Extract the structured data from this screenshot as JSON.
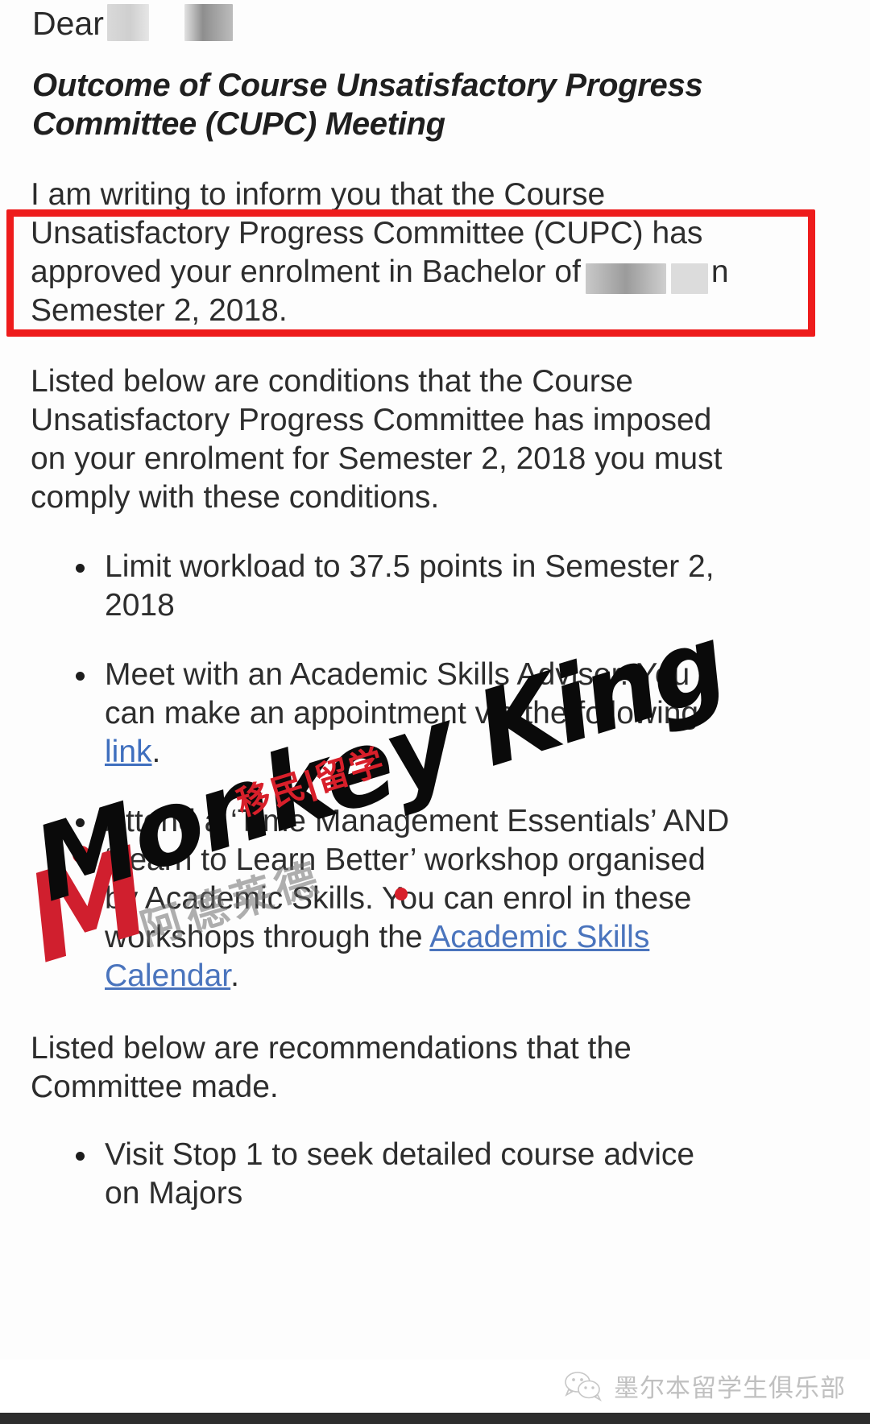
{
  "document": {
    "salutation": "Dear",
    "salutation_trailing": ",",
    "heading": "Outcome of Course Unsatisfactory Progress Committee (CUPC) Meeting",
    "intro_paragraph_part1": "I am writing to inform you that the Course Unsatisfactory Progress Committee (CUPC) has approved your enrolment in Bachelor of",
    "intro_paragraph_part2": "n Semester 2, 2018.",
    "conditions_paragraph": "Listed below are conditions that the Course Unsatisfactory Progress Committee has imposed on your enrolment for Semester 2, 2018 you must comply with these conditions.",
    "recommendations_paragraph": "Listed below are recommendations that the Committee made.",
    "conditions": [
      {
        "text_before": "Limit workload to 37.5 points in Semester 2, 2018",
        "link_text": "",
        "text_after": ""
      },
      {
        "text_before": "Meet with an Academic Skills Adviser. You can make an appointment via the following ",
        "link_text": "link",
        "text_after": "."
      },
      {
        "text_before": "Attend a ‘Time Management Essentials’ AND ‘Learn to Learn Better’ workshop organised by Academic Skills. You can enrol in these workshops through the ",
        "link_text": "Academic Skills Calendar",
        "text_after": "."
      }
    ],
    "recommendations": [
      {
        "text_before": "Visit Stop 1 to seek detailed course advice on Majors",
        "link_text": "",
        "text_after": ""
      }
    ]
  },
  "highlight": {
    "color": "#ee1c1c",
    "label": "red-emphasis-box"
  },
  "watermark": {
    "brand": "Monkey King",
    "brand_initial": "M",
    "chinese_red": "移民|留学",
    "chinese_grey": "阿德莱德",
    "color_red": "#d01f2e",
    "color_black": "#0a0a0a"
  },
  "footer": {
    "icon": "wechat-icon",
    "account_name": "墨尔本留学生俱乐部"
  },
  "link_color": "#3f6fbe"
}
